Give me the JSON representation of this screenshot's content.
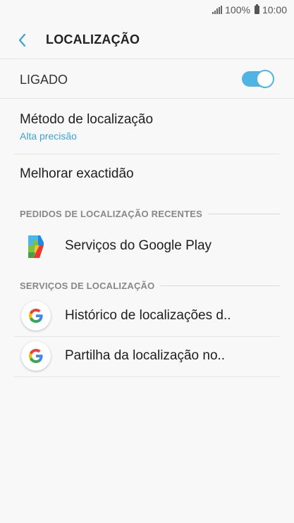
{
  "status": {
    "battery": "100%",
    "time": "10:00"
  },
  "header": {
    "title": "LOCALIZAÇÃO",
    "back_icon": "chevron-left-icon"
  },
  "master": {
    "label": "LIGADO",
    "toggle_on": true
  },
  "settings": [
    {
      "title": "Método de localização",
      "subtitle": "Alta precisão"
    },
    {
      "title": "Melhorar exactidão"
    }
  ],
  "recent": {
    "header": "PEDIDOS DE LOCALIZAÇÃO RECENTES",
    "items": [
      {
        "label": "Serviços do Google Play",
        "icon": "google-play-services-icon"
      }
    ]
  },
  "services": {
    "header": "SERVIÇOS DE LOCALIZAÇÃO",
    "items": [
      {
        "label": "Histórico de localizações d..",
        "icon": "google-g-icon"
      },
      {
        "label": "Partilha da localização no..",
        "icon": "google-g-icon"
      }
    ]
  },
  "colors": {
    "accent": "#4fb3e3",
    "subtitle": "#3ba2d6"
  }
}
